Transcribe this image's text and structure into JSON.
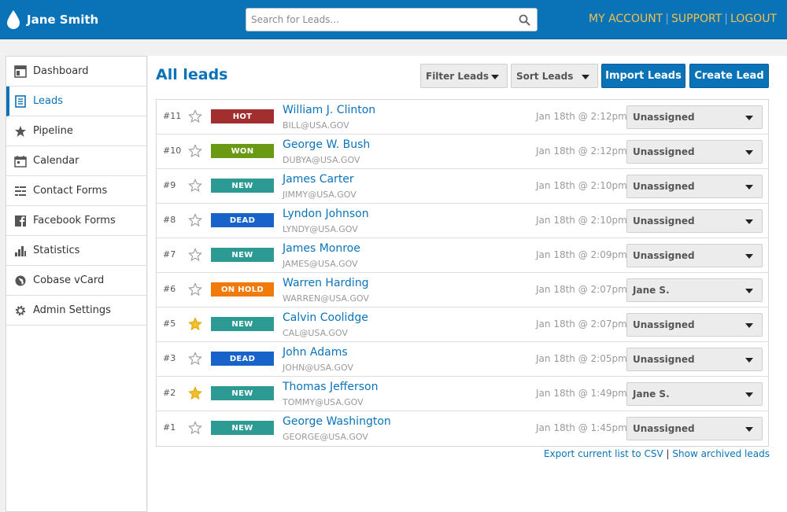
{
  "header": {
    "user_name": "Jane Smith",
    "search_placeholder": "Search for Leads...",
    "links": [
      "MY ACCOUNT",
      "SUPPORT",
      "LOGOUT"
    ]
  },
  "sidebar": {
    "items": [
      {
        "label": "Dashboard",
        "icon": "dashboard-icon"
      },
      {
        "label": "Leads",
        "icon": "leads-icon",
        "active": true
      },
      {
        "label": "Pipeline",
        "icon": "star-icon"
      },
      {
        "label": "Calendar",
        "icon": "calendar-icon"
      },
      {
        "label": "Contact Forms",
        "icon": "forms-icon"
      },
      {
        "label": "Facebook Forms",
        "icon": "facebook-icon"
      },
      {
        "label": "Statistics",
        "icon": "bar-chart-icon"
      },
      {
        "label": "Cobase vCard",
        "icon": "globe-icon"
      },
      {
        "label": "Admin Settings",
        "icon": "gear-icon"
      }
    ]
  },
  "main": {
    "title": "All leads",
    "filter_label": "Filter Leads",
    "sort_label": "Sort Leads",
    "import_label": "Import Leads",
    "create_label": "Create Lead",
    "export_link": "Export current list to CSV",
    "separator": "|",
    "archived_link": "Show archived leads"
  },
  "status_colors": {
    "HOT": "#a32e2e",
    "WON": "#6a9a12",
    "NEW": "#2e9a94",
    "DEAD": "#1763c9",
    "ON HOLD": "#f07a0a"
  },
  "leads": [
    {
      "num": "#11",
      "starred": false,
      "status": "HOT",
      "name": "William J. Clinton",
      "email": "BILL@USA.GOV",
      "date": "Jan 18th @ 2:12pm",
      "assigned": "Unassigned"
    },
    {
      "num": "#10",
      "starred": false,
      "status": "WON",
      "name": "George W. Bush",
      "email": "DUBYA@USA.GOV",
      "date": "Jan 18th @ 2:12pm",
      "assigned": "Unassigned"
    },
    {
      "num": "#9",
      "starred": false,
      "status": "NEW",
      "name": "James Carter",
      "email": "JIMMY@USA.GOV",
      "date": "Jan 18th @ 2:10pm",
      "assigned": "Unassigned"
    },
    {
      "num": "#8",
      "starred": false,
      "status": "DEAD",
      "name": "Lyndon Johnson",
      "email": "LYNDY@USA.GOV",
      "date": "Jan 18th @ 2:10pm",
      "assigned": "Unassigned"
    },
    {
      "num": "#7",
      "starred": false,
      "status": "NEW",
      "name": "James Monroe",
      "email": "JAMES@USA.GOV",
      "date": "Jan 18th @ 2:09pm",
      "assigned": "Unassigned"
    },
    {
      "num": "#6",
      "starred": false,
      "status": "ON HOLD",
      "name": "Warren Harding",
      "email": "WARREN@USA.GOV",
      "date": "Jan 18th @ 2:07pm",
      "assigned": "Jane S."
    },
    {
      "num": "#5",
      "starred": true,
      "status": "NEW",
      "name": "Calvin Coolidge",
      "email": "CAL@USA.GOV",
      "date": "Jan 18th @ 2:07pm",
      "assigned": "Unassigned"
    },
    {
      "num": "#3",
      "starred": false,
      "status": "DEAD",
      "name": "John Adams",
      "email": "JOHN@USA.GOV",
      "date": "Jan 18th @ 2:05pm",
      "assigned": "Unassigned"
    },
    {
      "num": "#2",
      "starred": true,
      "status": "NEW",
      "name": "Thomas Jefferson",
      "email": "TOMMY@USA.GOV",
      "date": "Jan 18th @ 1:49pm",
      "assigned": "Jane S."
    },
    {
      "num": "#1",
      "starred": false,
      "status": "NEW",
      "name": "George Washington",
      "email": "GEORGE@USA.GOV",
      "date": "Jan 18th @ 1:45pm",
      "assigned": "Unassigned"
    }
  ]
}
